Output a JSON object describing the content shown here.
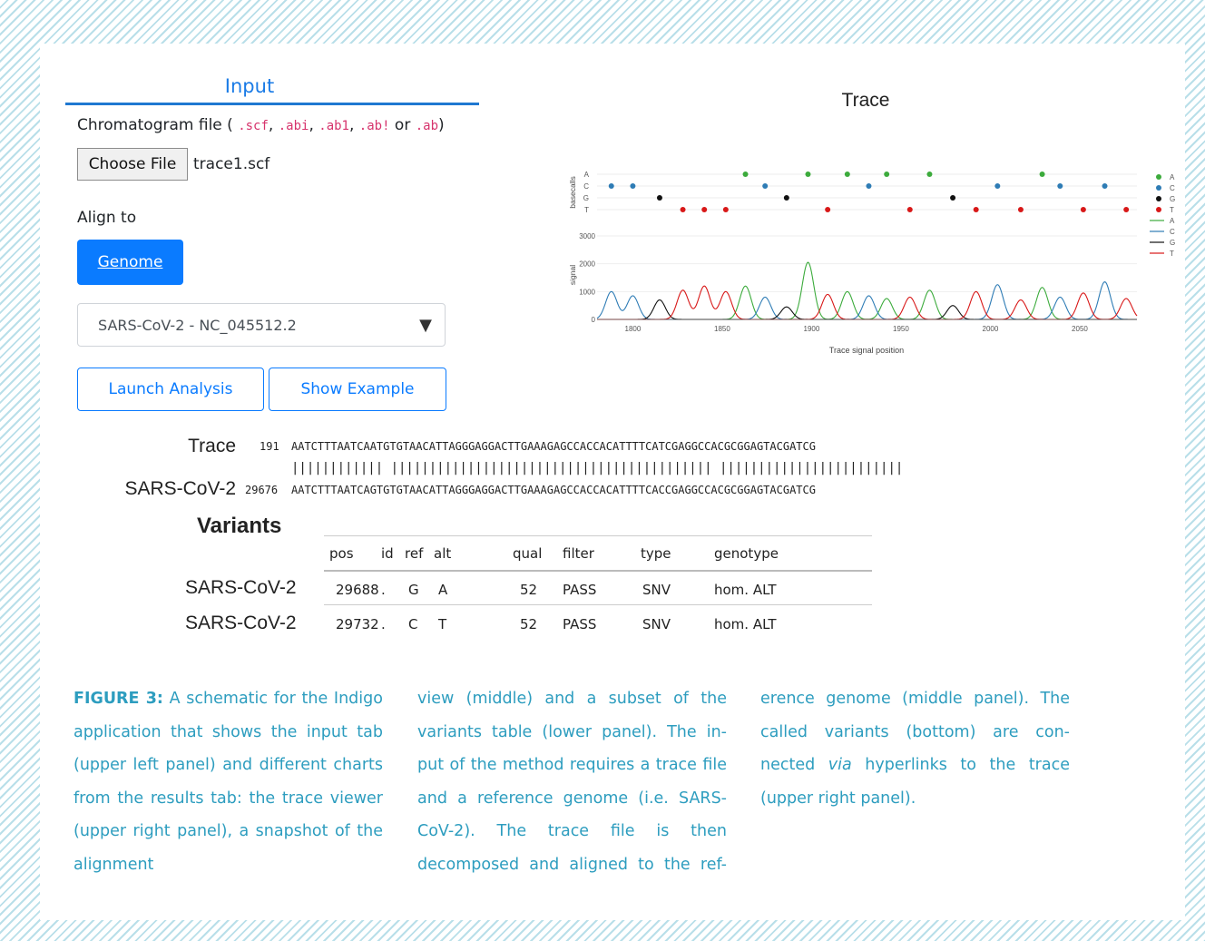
{
  "input_tab": {
    "title": "Input",
    "chromatogram_label": "Chromatogram file (",
    "ext_scf": ".scf",
    "ext_abi": ".abi",
    "ext_ab1": ".ab1",
    "ext_ab_bang": ".ab!",
    "ext_ab": ".ab",
    "sep_comma": ",",
    "sep_or": "or",
    "close_paren": ")",
    "choose_file_label": "Choose File",
    "file_name": "trace1.scf",
    "align_to_label": "Align to",
    "genome_button": "Genome",
    "genome_select": "SARS-CoV-2 - NC_045512.2",
    "select_arrow": "▼",
    "launch_button": "Launch Analysis",
    "example_button": "Show Example"
  },
  "chart_data": {
    "type": "line",
    "title": "Trace",
    "xlabel": "Trace signal position",
    "basecalls_ylabel": "basecalls",
    "signal_ylabel": "signal",
    "xlim": [
      1780,
      2082
    ],
    "xticks": [
      1800,
      1850,
      1900,
      1950,
      2000,
      2050
    ],
    "ylim": [
      0,
      3000
    ],
    "yticks": [
      0,
      1000,
      2000,
      3000
    ],
    "basecall_levels": [
      "A",
      "C",
      "G",
      "T"
    ],
    "colors": {
      "A": "#3cab3c",
      "C": "#2e7cb5",
      "G": "#111111",
      "T": "#d81818"
    },
    "legend_position": "right",
    "legend": {
      "points": [
        "A",
        "C",
        "G",
        "T"
      ],
      "lines": [
        "A",
        "C",
        "G",
        "T"
      ]
    },
    "basecalls": [
      {
        "x": 1788,
        "base": "C"
      },
      {
        "x": 1800,
        "base": "C"
      },
      {
        "x": 1815,
        "base": "G"
      },
      {
        "x": 1828,
        "base": "T"
      },
      {
        "x": 1840,
        "base": "T"
      },
      {
        "x": 1852,
        "base": "T"
      },
      {
        "x": 1863,
        "base": "A"
      },
      {
        "x": 1874,
        "base": "C"
      },
      {
        "x": 1886,
        "base": "G"
      },
      {
        "x": 1898,
        "base": "A"
      },
      {
        "x": 1909,
        "base": "T"
      },
      {
        "x": 1920,
        "base": "A"
      },
      {
        "x": 1932,
        "base": "C"
      },
      {
        "x": 1942,
        "base": "A"
      },
      {
        "x": 1955,
        "base": "T"
      },
      {
        "x": 1966,
        "base": "A"
      },
      {
        "x": 1979,
        "base": "G"
      },
      {
        "x": 1992,
        "base": "T"
      },
      {
        "x": 2004,
        "base": "C"
      },
      {
        "x": 2017,
        "base": "T"
      },
      {
        "x": 2029,
        "base": "A"
      },
      {
        "x": 2039,
        "base": "C"
      },
      {
        "x": 2052,
        "base": "T"
      },
      {
        "x": 2064,
        "base": "C"
      },
      {
        "x": 2076,
        "base": "T"
      }
    ],
    "peaks": [
      {
        "x": 1788,
        "base": "C",
        "value": 1000
      },
      {
        "x": 1800,
        "base": "C",
        "value": 850
      },
      {
        "x": 1815,
        "base": "G",
        "value": 700
      },
      {
        "x": 1828,
        "base": "T",
        "value": 1050
      },
      {
        "x": 1840,
        "base": "T",
        "value": 1200
      },
      {
        "x": 1852,
        "base": "T",
        "value": 1000
      },
      {
        "x": 1863,
        "base": "A",
        "value": 1200
      },
      {
        "x": 1874,
        "base": "C",
        "value": 800
      },
      {
        "x": 1886,
        "base": "G",
        "value": 450
      },
      {
        "x": 1898,
        "base": "A",
        "value": 2050
      },
      {
        "x": 1909,
        "base": "T",
        "value": 900
      },
      {
        "x": 1920,
        "base": "A",
        "value": 1000
      },
      {
        "x": 1932,
        "base": "C",
        "value": 850
      },
      {
        "x": 1942,
        "base": "A",
        "value": 750
      },
      {
        "x": 1955,
        "base": "T",
        "value": 800
      },
      {
        "x": 1966,
        "base": "A",
        "value": 1050
      },
      {
        "x": 1979,
        "base": "G",
        "value": 500
      },
      {
        "x": 1992,
        "base": "T",
        "value": 1000
      },
      {
        "x": 2004,
        "base": "C",
        "value": 1250
      },
      {
        "x": 2017,
        "base": "T",
        "value": 700
      },
      {
        "x": 2029,
        "base": "A",
        "value": 1150
      },
      {
        "x": 2039,
        "base": "C",
        "value": 800
      },
      {
        "x": 2052,
        "base": "T",
        "value": 950
      },
      {
        "x": 2064,
        "base": "C",
        "value": 1350
      },
      {
        "x": 2076,
        "base": "T",
        "value": 750
      }
    ]
  },
  "alignment": {
    "trace_name": "Trace",
    "trace_pos": "191",
    "trace_seq": "AATCTTTAATCAATGTGTAACATTAGGGAGGACTTGAAAGAGCCACCACATTTTCATCGAGGCCACGCGGAGTACGATCG",
    "match_line": "|||||||||||| |||||||||||||||||||||||||||||||||||||||||| ||||||||||||||||||||||||",
    "ref_name": "SARS-CoV-2",
    "ref_pos": "29676",
    "ref_seq": "AATCTTTAATCAGTGTGTAACATTAGGGAGGACTTGAAAGAGCCACCACATTTTCACCGAGGCCACGCGGAGTACGATCG"
  },
  "variants": {
    "title": "Variants",
    "columns": [
      "pos",
      "id",
      "ref",
      "alt",
      "qual",
      "filter",
      "type",
      "genotype"
    ],
    "rows": [
      {
        "chrom": "SARS-CoV-2",
        "pos": "29688",
        "id": ".",
        "ref": "G",
        "alt": "A",
        "qual": "52",
        "filter": "PASS",
        "type": "SNV",
        "genotype": "hom. ALT"
      },
      {
        "chrom": "SARS-CoV-2",
        "pos": "29732",
        "id": ".",
        "ref": "C",
        "alt": "T",
        "qual": "52",
        "filter": "PASS",
        "type": "SNV",
        "genotype": "hom. ALT"
      }
    ]
  },
  "caption": {
    "label": "FIGURE 3:",
    "col1_text": "A schematic for the Indigo application that shows the input tab (upper left panel) and different charts from the results tab: the trace viewer (upper right panel), a snapshot of the alignment",
    "col2_text": "view (middle) and a subset of the variants table (lower panel). The in- put of the method requires a trace file and a reference genome (i.e. SARS-CoV-2). The trace file is then decomposed and aligned to the ref-",
    "col3_a": "erence genome (middle panel). The called variants (bottom) are con- nected",
    "col3_via": "via",
    "col3_b": "hyperlinks to the trace (upper right panel)."
  }
}
